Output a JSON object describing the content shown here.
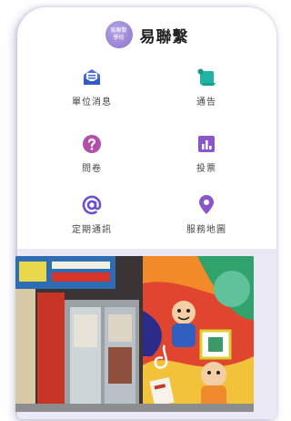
{
  "header": {
    "logo_line1": "易聯繫",
    "logo_line2": "學校",
    "title": "易聯繫"
  },
  "menu": [
    {
      "label": "單位消息",
      "icon": "envelope-news-icon"
    },
    {
      "label": "通告",
      "icon": "scroll-notice-icon"
    },
    {
      "label": "問卷",
      "icon": "question-circle-icon"
    },
    {
      "label": "投票",
      "icon": "bar-chart-vote-icon"
    },
    {
      "label": "定期通訊",
      "icon": "at-sign-icon"
    },
    {
      "label": "服務地圖",
      "icon": "map-pin-icon"
    }
  ],
  "colors": {
    "accent_purple": "#8a56c9",
    "accent_blue": "#3f6fd8",
    "accent_teal": "#1fb4a3",
    "band": "#ebe9f6"
  }
}
